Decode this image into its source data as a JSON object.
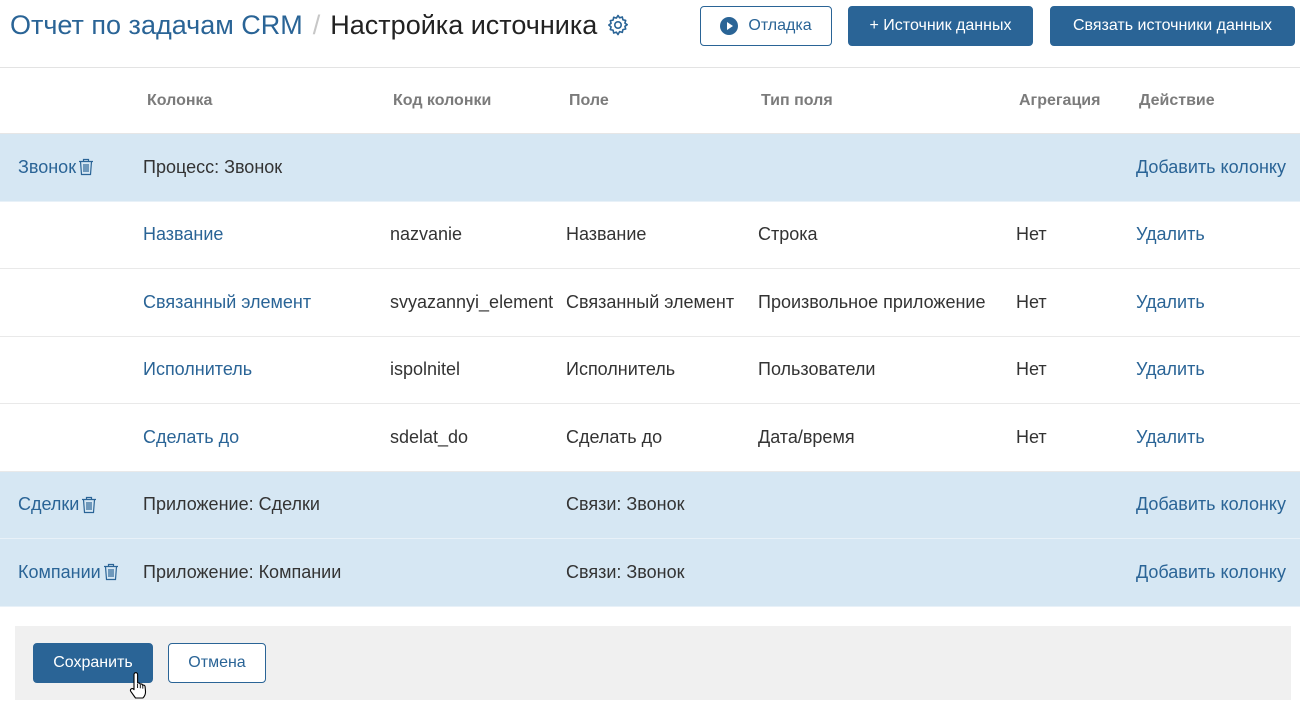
{
  "header": {
    "breadcrumb_root": "Отчет по задачам CRM",
    "breadcrumb_separator": "/",
    "page_title": "Настройка источника",
    "settings_icon": "gear-icon",
    "debug_label": "Отладка",
    "add_source_label": "+ Источник данных",
    "link_sources_label": "Связать источники данных"
  },
  "table": {
    "columns": [
      "Колонка",
      "Код колонки",
      "Поле",
      "Тип поля",
      "Агрегация",
      "Действие"
    ],
    "groups": [
      {
        "name": "Звонок",
        "description": "Процесс: Звонок",
        "field": "",
        "action": "Добавить колонку",
        "rows": [
          {
            "column": "Название",
            "code": "nazvanie",
            "field": "Название",
            "type": "Строка",
            "aggregation": "Нет",
            "action": "Удалить"
          },
          {
            "column": "Связанный элемент",
            "code": "svyazannyi_element",
            "field": "Связанный элемент",
            "type": "Произвольное приложение",
            "aggregation": "Нет",
            "action": "Удалить"
          },
          {
            "column": "Исполнитель",
            "code": "ispolnitel",
            "field": "Исполнитель",
            "type": "Пользователи",
            "aggregation": "Нет",
            "action": "Удалить"
          },
          {
            "column": "Сделать до",
            "code": "sdelat_do",
            "field": "Сделать до",
            "type": "Дата/время",
            "aggregation": "Нет",
            "action": "Удалить"
          }
        ]
      },
      {
        "name": "Сделки",
        "description": "Приложение: Сделки",
        "field": "Связи: Звонок",
        "action": "Добавить колонку",
        "rows": []
      },
      {
        "name": "Компании",
        "description": "Приложение: Компании",
        "field": "Связи: Звонок",
        "action": "Добавить колонку",
        "rows": []
      }
    ]
  },
  "footer": {
    "save_label": "Сохранить",
    "cancel_label": "Отмена"
  },
  "colors": {
    "accent": "#2a6496",
    "group_row_bg": "#d6e7f3",
    "footer_bg": "#f0f0f0"
  }
}
